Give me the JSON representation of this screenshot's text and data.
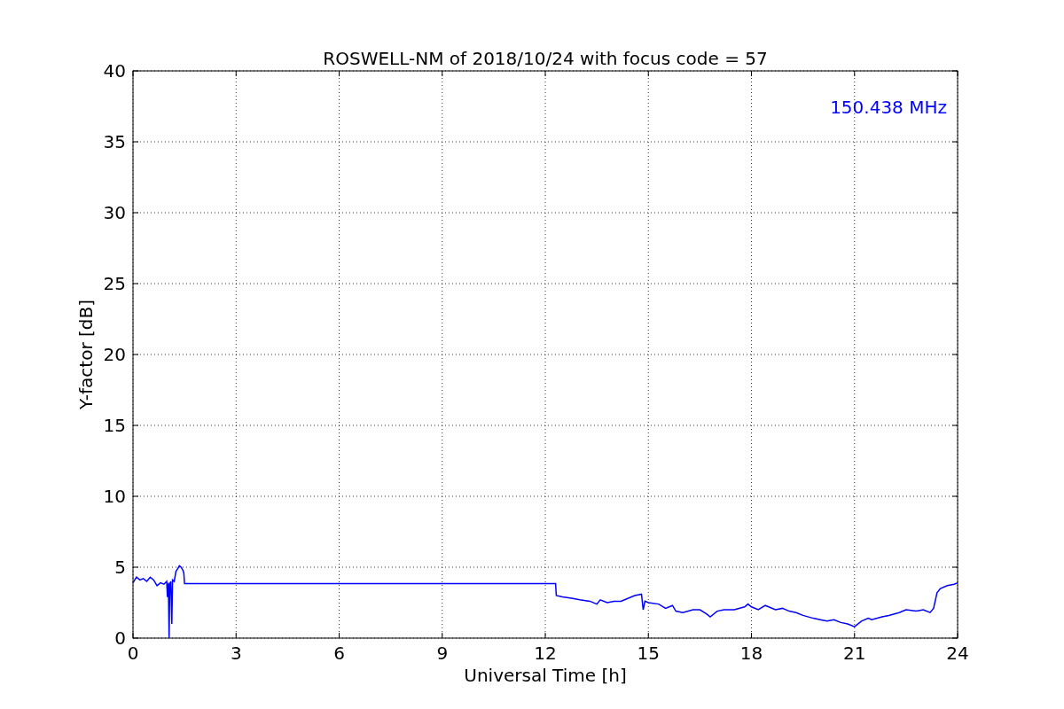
{
  "chart_data": {
    "type": "line",
    "title": "ROSWELL-NM of 2018/10/24 with focus code = 57",
    "xlabel": "Universal Time [h]",
    "ylabel": "Y-factor [dB]",
    "x": [
      0,
      0.1,
      0.2,
      0.3,
      0.4,
      0.5,
      0.6,
      0.7,
      0.8,
      0.9,
      0.98,
      1.0,
      1.03,
      1.05,
      1.07,
      1.1,
      1.13,
      1.15,
      1.2,
      1.25,
      1.3,
      1.35,
      1.4,
      1.45,
      1.48,
      1.5,
      12.3,
      12.32,
      12.5,
      12.8,
      13.0,
      13.3,
      13.5,
      13.6,
      13.8,
      14.0,
      14.2,
      14.4,
      14.6,
      14.8,
      14.85,
      14.9,
      15.0,
      15.3,
      15.5,
      15.7,
      15.8,
      16.0,
      16.3,
      16.5,
      16.7,
      16.8,
      17.0,
      17.2,
      17.5,
      17.8,
      17.9,
      18.0,
      18.2,
      18.4,
      18.5,
      18.7,
      18.9,
      19.1,
      19.3,
      19.5,
      19.8,
      20.0,
      20.2,
      20.4,
      20.6,
      20.8,
      21.0,
      21.2,
      21.4,
      21.5,
      21.8,
      22.0,
      22.3,
      22.5,
      22.8,
      23.0,
      23.2,
      23.3,
      23.4,
      23.5,
      23.7,
      23.9,
      24.0
    ],
    "series": [
      {
        "name": "150.438 MHz",
        "color": "#0000ff",
        "values": [
          3.9,
          4.3,
          4.1,
          4.2,
          4.0,
          4.3,
          4.1,
          3.7,
          3.9,
          3.8,
          4.0,
          2.9,
          3.9,
          0,
          3.8,
          4.0,
          1.0,
          4.1,
          4.0,
          4.7,
          4.9,
          5.1,
          5.0,
          4.8,
          4.6,
          3.85,
          3.85,
          3.0,
          2.9,
          2.8,
          2.7,
          2.6,
          2.4,
          2.7,
          2.5,
          2.6,
          2.6,
          2.8,
          3.0,
          3.1,
          2.0,
          2.6,
          2.5,
          2.4,
          2.1,
          2.3,
          1.9,
          1.8,
          2.0,
          2.0,
          1.7,
          1.5,
          1.9,
          2.0,
          2.0,
          2.2,
          2.4,
          2.2,
          2.0,
          2.3,
          2.2,
          2.0,
          2.1,
          1.9,
          1.8,
          1.6,
          1.4,
          1.3,
          1.2,
          1.3,
          1.1,
          1.0,
          0.8,
          1.2,
          1.4,
          1.3,
          1.5,
          1.6,
          1.8,
          2.0,
          1.9,
          2.0,
          1.8,
          2.1,
          3.2,
          3.5,
          3.7,
          3.8,
          3.9
        ]
      }
    ],
    "xlim": [
      0,
      24
    ],
    "ylim": [
      0,
      40
    ],
    "xticks": [
      0,
      3,
      6,
      9,
      12,
      15,
      18,
      21,
      24
    ],
    "yticks": [
      0,
      5,
      10,
      15,
      20,
      25,
      30,
      35,
      40
    ],
    "grid": true
  }
}
